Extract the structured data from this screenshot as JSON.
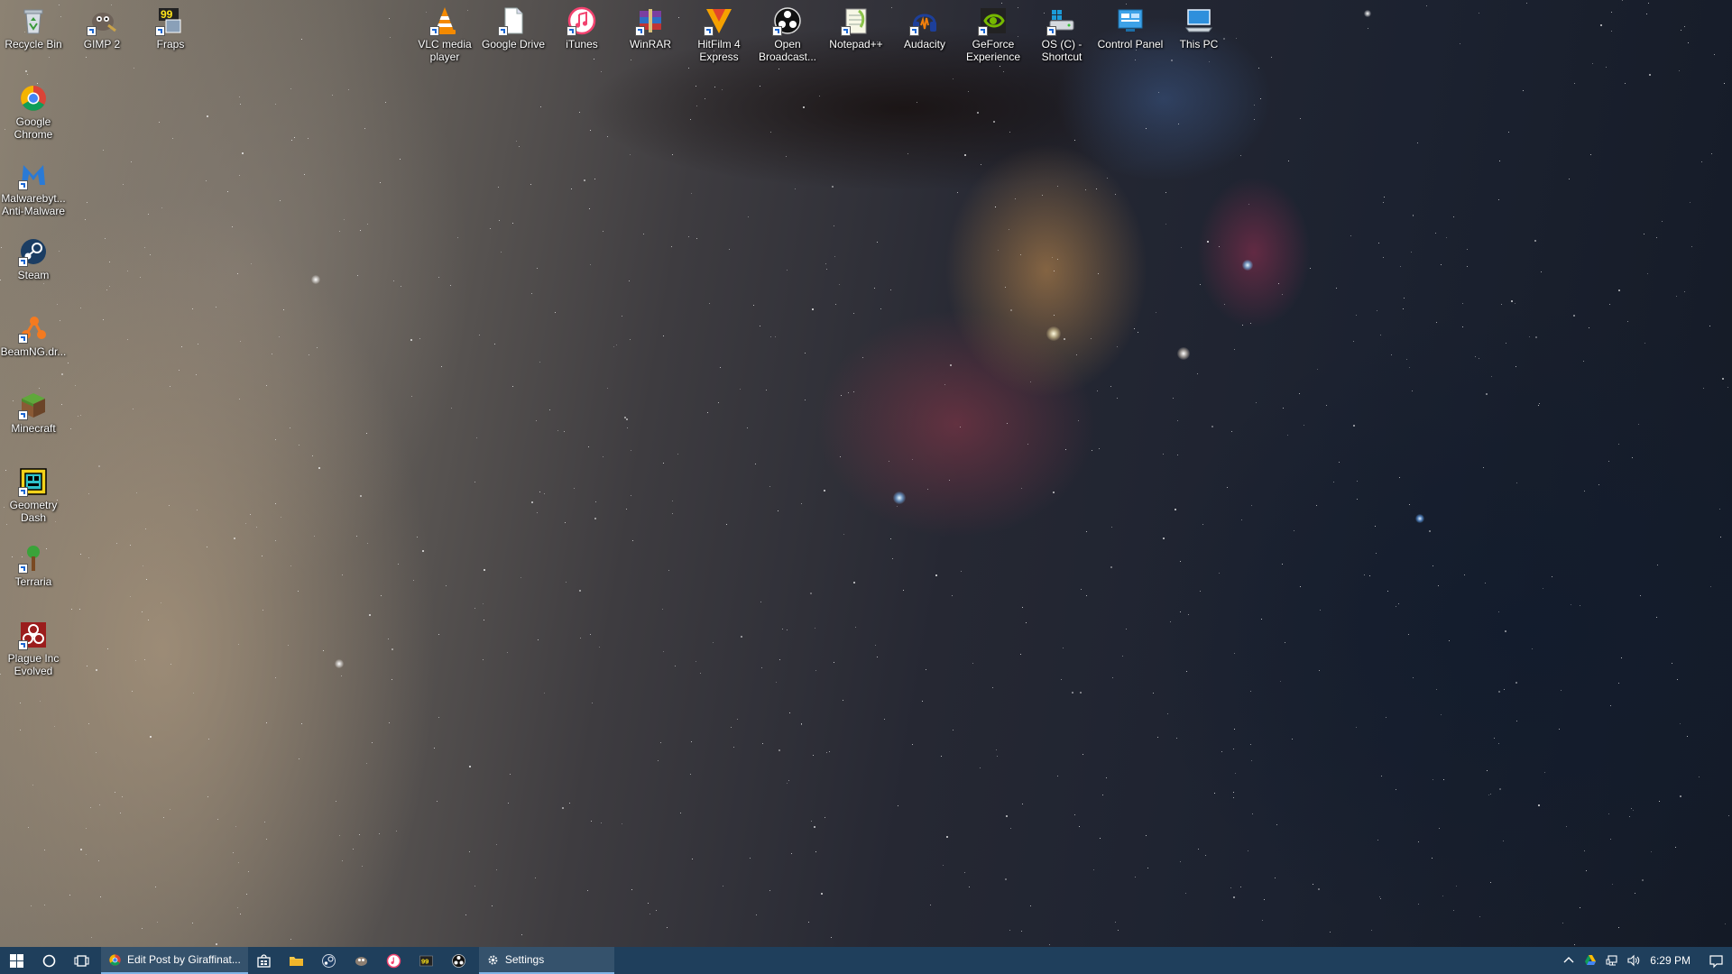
{
  "desktop": {
    "icons_top": [
      {
        "id": "recycle-bin",
        "label": "Recycle Bin",
        "shortcut": false
      },
      {
        "id": "gimp",
        "label": "GIMP 2",
        "shortcut": true
      },
      {
        "id": "fraps",
        "label": "Fraps",
        "shortcut": true
      },
      {
        "id": "vlc",
        "label": "VLC media player",
        "shortcut": true
      },
      {
        "id": "google-drive",
        "label": "Google Drive",
        "shortcut": true
      },
      {
        "id": "itunes",
        "label": "iTunes",
        "shortcut": true
      },
      {
        "id": "winrar",
        "label": "WinRAR",
        "shortcut": true
      },
      {
        "id": "hitfilm",
        "label": "HitFilm 4 Express",
        "shortcut": true
      },
      {
        "id": "obs",
        "label": "Open Broadcast...",
        "shortcut": true
      },
      {
        "id": "notepadpp",
        "label": "Notepad++",
        "shortcut": true
      },
      {
        "id": "audacity",
        "label": "Audacity",
        "shortcut": true
      },
      {
        "id": "geforce",
        "label": "GeForce Experience",
        "shortcut": true
      },
      {
        "id": "os-c",
        "label": "OS (C) - Shortcut",
        "shortcut": true
      },
      {
        "id": "control-panel",
        "label": "Control Panel",
        "shortcut": false
      },
      {
        "id": "this-pc",
        "label": "This PC",
        "shortcut": false
      }
    ],
    "icons_left": [
      {
        "id": "chrome",
        "label": "Google Chrome",
        "shortcut": false
      },
      {
        "id": "malwarebytes",
        "label": "Malwarebyt... Anti-Malware",
        "shortcut": true
      },
      {
        "id": "steam",
        "label": "Steam",
        "shortcut": true
      },
      {
        "id": "beamng",
        "label": "BeamNG.dr...",
        "shortcut": true
      },
      {
        "id": "minecraft",
        "label": "Minecraft",
        "shortcut": true
      },
      {
        "id": "geometry-dash",
        "label": "Geometry Dash",
        "shortcut": true
      },
      {
        "id": "terraria",
        "label": "Terraria",
        "shortcut": true
      },
      {
        "id": "plague-inc",
        "label": "Plague Inc Evolved",
        "shortcut": true
      }
    ]
  },
  "taskbar": {
    "chrome_window_label": "Edit Post by Giraffinat...",
    "settings_window_label": "Settings",
    "clock": "6:29 PM"
  },
  "colors": {
    "taskbar_bg": "#1f3f5c",
    "active_underline": "#7fb4e6"
  }
}
